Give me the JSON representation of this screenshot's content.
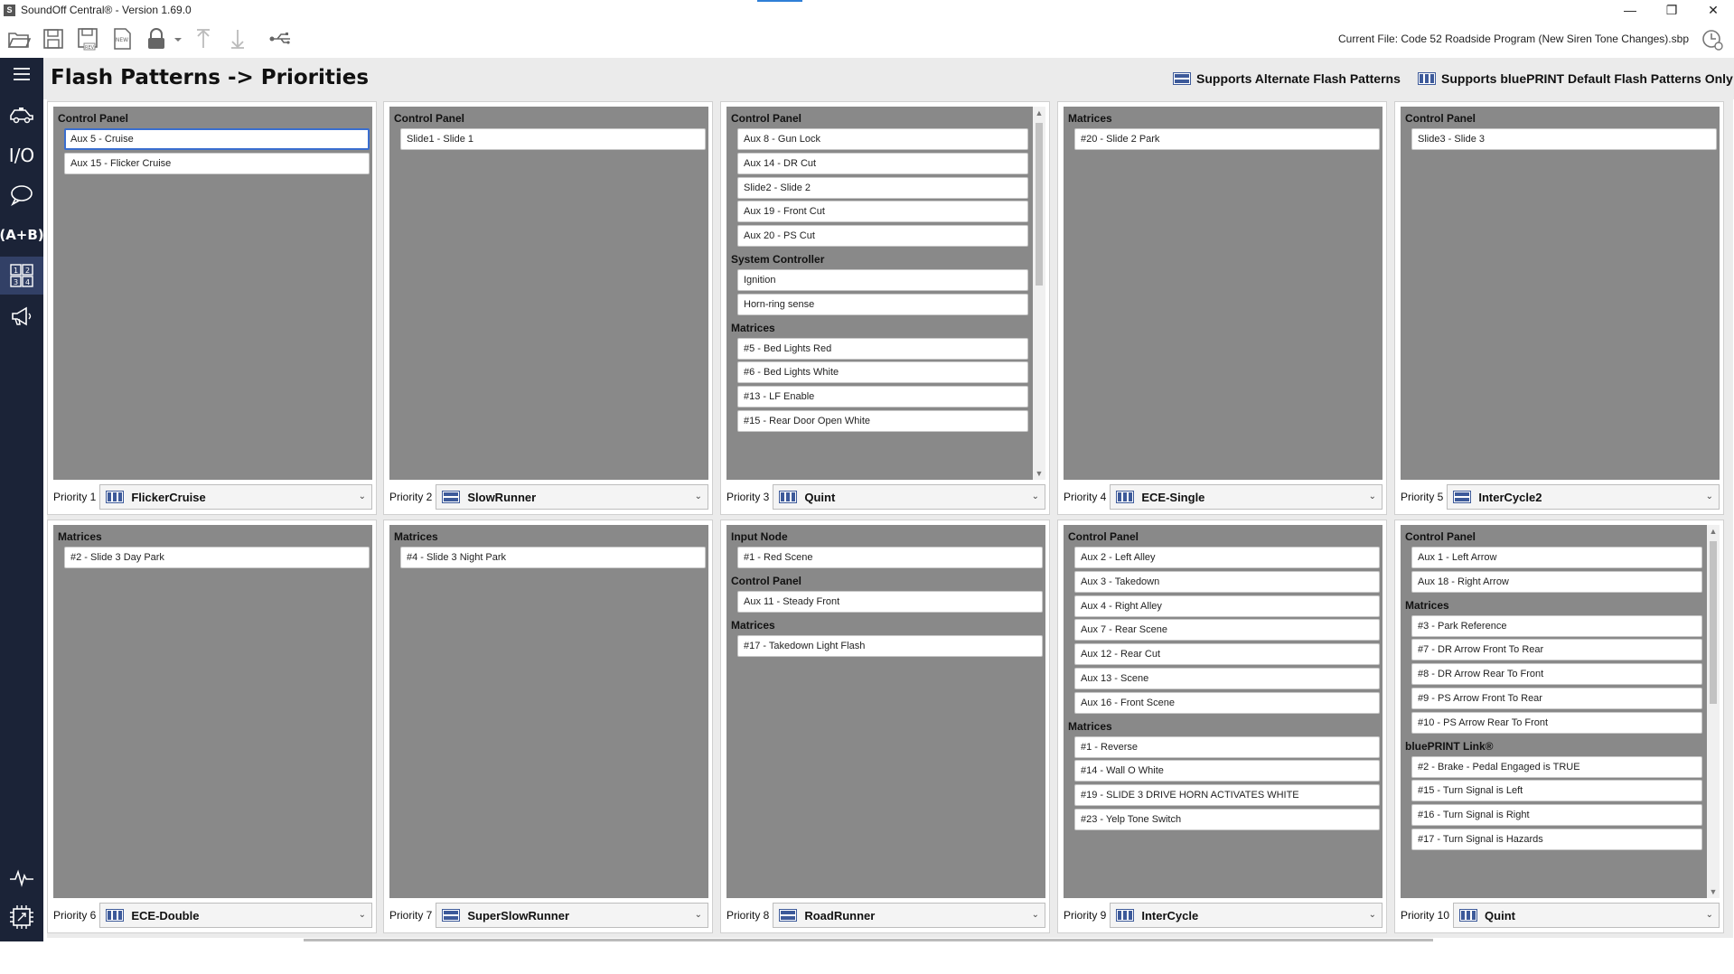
{
  "window": {
    "title": "SoundOff Central® - Version 1.69.0",
    "app_icon": "S",
    "controls": [
      "—",
      "❐",
      "✕"
    ]
  },
  "toolbar": {
    "buttons": [
      "open-folder-icon",
      "save-icon",
      "save-rev-icon",
      "new-icon",
      "lock-icon",
      "upload-icon",
      "download-icon",
      "usb-icon"
    ],
    "current_file": "Current File: Code 52 Roadside Program (New Siren Tone Changes).sbp"
  },
  "sidebar": {
    "items": [
      {
        "icon": "menu-icon"
      },
      {
        "icon": "vehicle-icon"
      },
      {
        "icon": "io-icon",
        "text": "I/O"
      },
      {
        "icon": "chat-icon"
      },
      {
        "icon": "ab-icon",
        "text": "(A+B)"
      },
      {
        "icon": "priorities-grid-icon",
        "active": true
      },
      {
        "icon": "megaphone-icon"
      },
      {
        "icon": "waveform-icon"
      },
      {
        "icon": "chip-icon"
      },
      {
        "icon": "help-icon"
      }
    ]
  },
  "header": {
    "title": "Flash Patterns -> Priorities",
    "legend_alternate": "Supports Alternate Flash Patterns",
    "legend_blueprint": "Supports bluePRINT Default Flash Patterns Only"
  },
  "colors": {
    "sidebar_bg": "#1b2337",
    "panel_body": "#898989",
    "accent": "#3a6ecf",
    "icon_blue": "#3d5a9a"
  },
  "panels": [
    {
      "priority": "Priority 1",
      "pattern": "FlickerCruise",
      "icon": "blueprint",
      "scroll": false,
      "sections": [
        {
          "head": "Control Panel",
          "items": [
            "Aux 5 - Cruise",
            "Aux 15 - Flicker Cruise"
          ]
        }
      ]
    },
    {
      "priority": "Priority 2",
      "pattern": "SlowRunner",
      "icon": "alternate",
      "scroll": false,
      "sections": [
        {
          "head": "Control Panel",
          "items": [
            "Slide1 - Slide 1"
          ]
        }
      ]
    },
    {
      "priority": "Priority 3",
      "pattern": "Quint",
      "icon": "blueprint",
      "scroll": true,
      "sections": [
        {
          "head": "Control Panel",
          "items": [
            "Aux 8 - Gun Lock",
            "Aux 14 - DR Cut",
            "Slide2 - Slide 2",
            "Aux 19 - Front Cut",
            "Aux 20 - PS Cut"
          ]
        },
        {
          "head": "System Controller",
          "items": [
            "Ignition",
            "Horn-ring sense"
          ]
        },
        {
          "head": "Matrices",
          "items": [
            "#5 - Bed Lights Red",
            "#6 - Bed Lights White",
            "#13 - LF Enable",
            "#15 - Rear Door Open White"
          ]
        }
      ]
    },
    {
      "priority": "Priority 4",
      "pattern": "ECE-Single",
      "icon": "blueprint",
      "scroll": false,
      "sections": [
        {
          "head": "Matrices",
          "items": [
            "#20 - Slide 2 Park"
          ]
        }
      ]
    },
    {
      "priority": "Priority 5",
      "pattern": "InterCycle2",
      "icon": "alternate",
      "scroll": false,
      "sections": [
        {
          "head": "Control Panel",
          "items": [
            "Slide3 - Slide 3"
          ]
        }
      ]
    },
    {
      "priority": "Priority 6",
      "pattern": "ECE-Double",
      "icon": "blueprint",
      "scroll": false,
      "sections": [
        {
          "head": "Matrices",
          "items": [
            "#2 - Slide 3 Day Park"
          ]
        }
      ]
    },
    {
      "priority": "Priority 7",
      "pattern": "SuperSlowRunner",
      "icon": "alternate",
      "scroll": false,
      "sections": [
        {
          "head": "Matrices",
          "items": [
            "#4 - Slide 3 Night Park"
          ]
        }
      ]
    },
    {
      "priority": "Priority 8",
      "pattern": "RoadRunner",
      "icon": "alternate",
      "scroll": false,
      "sections": [
        {
          "head": "Input Node",
          "items": [
            "#1 - Red Scene"
          ]
        },
        {
          "head": "Control Panel",
          "items": [
            "Aux 11 - Steady Front"
          ]
        },
        {
          "head": "Matrices",
          "items": [
            "#17 - Takedown Light Flash"
          ]
        }
      ]
    },
    {
      "priority": "Priority 9",
      "pattern": "InterCycle",
      "icon": "blueprint",
      "scroll": false,
      "sections": [
        {
          "head": "Control Panel",
          "items": [
            "Aux 2 - Left Alley",
            "Aux 3 - Takedown",
            "Aux 4 - Right Alley",
            "Aux 7 - Rear Scene",
            "Aux 12 - Rear Cut",
            "Aux 13 - Scene",
            "Aux 16 - Front Scene"
          ]
        },
        {
          "head": "Matrices",
          "items": [
            "#1 - Reverse",
            "#14 - Wall O White",
            "#19 - SLIDE 3 DRIVE HORN ACTIVATES WHITE",
            "#23 - Yelp Tone Switch"
          ]
        }
      ]
    },
    {
      "priority": "Priority 10",
      "pattern": "Quint",
      "icon": "blueprint",
      "scroll": true,
      "sections": [
        {
          "head": "Control Panel",
          "items": [
            "Aux 1 - Left Arrow",
            "Aux 18 - Right Arrow"
          ]
        },
        {
          "head": "Matrices",
          "items": [
            "#3 - Park Reference",
            "#7 - DR Arrow Front To Rear",
            "#8 - DR Arrow Rear To Front",
            "#9 - PS Arrow Front To Rear",
            "#10 - PS Arrow Rear To Front"
          ]
        },
        {
          "head": "bluePRINT Link®",
          "items": [
            "#2 - Brake - Pedal Engaged is TRUE",
            "#15 - Turn Signal is Left",
            "#16 - Turn Signal is Right",
            "#17 - Turn Signal is Hazards"
          ]
        }
      ]
    }
  ]
}
